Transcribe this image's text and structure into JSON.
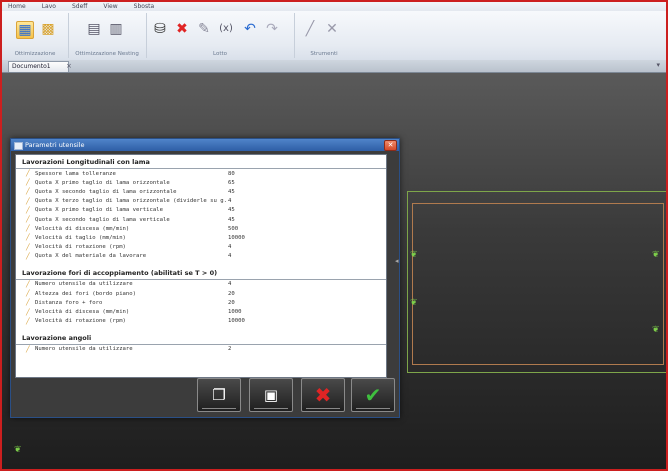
{
  "menu": [
    "Home",
    "Lavo",
    "Sdeff",
    "View",
    "Sbosta"
  ],
  "ribbon": {
    "groups": [
      {
        "label": "Ottimizzazione"
      },
      {
        "label": "Ottimizzazione Nesting"
      },
      {
        "label": "Lotto"
      },
      {
        "label": "Strumenti"
      }
    ]
  },
  "tabs": {
    "active": "Documento1"
  },
  "dialog": {
    "title": "Parametri utensile",
    "sections": [
      {
        "heading": "Lavorazioni Longitudinali con lama",
        "rows": [
          {
            "name": "Spessore lama tolleranze",
            "value": "80"
          },
          {
            "name": "Quota X primo taglio di lama orizzontale",
            "value": "65"
          },
          {
            "name": "Quota X secondo taglio di lama orizzontale",
            "value": "45"
          },
          {
            "name": "Quota X terzo taglio di lama orizzontale (dividerle su g...",
            "value": "4"
          },
          {
            "name": "Quota X primo taglio di lama verticale",
            "value": "45"
          },
          {
            "name": "Quota X secondo taglio di lama verticale",
            "value": "45"
          },
          {
            "name": "Velocità di discesa (mm/min)",
            "value": "500"
          },
          {
            "name": "Velocità di taglio (mm/min)",
            "value": "10000"
          },
          {
            "name": "Velocità di rotazione (rpm)",
            "value": "4"
          },
          {
            "name": "Quota X del materiale da lavorare",
            "value": "4"
          }
        ]
      },
      {
        "heading": "Lavorazione fori di accoppiamento (abilitati se T > 0)",
        "rows": [
          {
            "name": "Numero utensile da utilizzare",
            "value": "4"
          },
          {
            "name": "Altezza dei fori (bordo piano)",
            "value": "20"
          },
          {
            "name": "Distanza foro + foro",
            "value": "20"
          },
          {
            "name": "Velocità di discesa (mm/min)",
            "value": "1000"
          },
          {
            "name": "Velocità di rotazione (rpm)",
            "value": "10000"
          }
        ]
      },
      {
        "heading": "Lavorazione angoli",
        "rows": [
          {
            "name": "Numero utensile da utilizzare",
            "value": "2"
          }
        ]
      }
    ]
  },
  "colors": {
    "border": "#cc1f1f",
    "titlebar": "#2e5ea6",
    "part_outline": "#7ea64a",
    "accent_green": "#3fbf3f",
    "accent_red": "#e02424"
  },
  "icons": [
    "open-icon",
    "save-icon",
    "cancel-icon",
    "confirm-icon"
  ]
}
